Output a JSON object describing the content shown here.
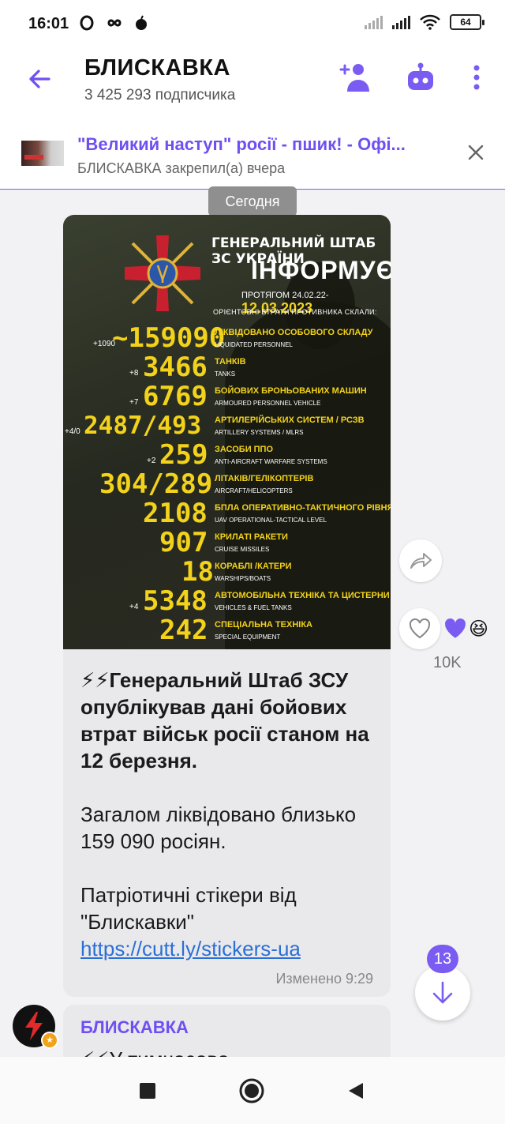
{
  "status_bar": {
    "time": "16:01",
    "left_icons": [
      "opera-icon",
      "infinity-icon",
      "bomb-icon"
    ],
    "battery": "64"
  },
  "header": {
    "title": "БЛИСКАВКА",
    "subtitle": "3 425 293 подписчика"
  },
  "pinned": {
    "title": "\"Великий наступ\" росії - пшик! - Офі...",
    "subtitle": "БЛИСКАВКА закрепил(а) вчера"
  },
  "date_chip": "Сегодня",
  "poster": {
    "heading": "ГЕНЕРАЛЬНИЙ ШТАБ ЗС УКРАЇНИ",
    "title": "ІНФОРМУЄ",
    "range_prefix": "ПРОТЯГОМ 24.02.22-",
    "range_date": "12.03.2023",
    "note": "ОРІЄНТОВНІ ВТРАТИ ПРОТИВНИКА СКЛАЛИ:",
    "stats": [
      {
        "delta": "+1090",
        "value": "~159090",
        "label": "ЛІКВІДОВАНО ОСОБОВОГО СКЛАДУ",
        "en": "LIQUIDATED PERSONNEL"
      },
      {
        "delta": "+8",
        "value": "3466",
        "label": "ТАНКІВ",
        "en": "TANKS"
      },
      {
        "delta": "+7",
        "value": "6769",
        "label": "БОЙОВИХ БРОНЬОВАНИХ МАШИН",
        "en": "ARMOURED PERSONNEL VEHICLE"
      },
      {
        "delta": "+4/0",
        "value": "2487/493",
        "label": "АРТИЛЕРІЙСЬКИХ СИСТЕМ / РСЗВ",
        "en": "ARTILLERY SYSTEMS / MLRS"
      },
      {
        "delta": "+2",
        "value": "259",
        "label": "ЗАСОБИ ППО",
        "en": "ANTI-AIRCRAFT WARFARE SYSTEMS"
      },
      {
        "delta": "",
        "value": "304/289",
        "label": "ЛІТАКІВ/ГЕЛІКОПТЕРІВ",
        "en": "AIRCRAFT/HELICOPTERS"
      },
      {
        "delta": "",
        "value": "2108",
        "label": "БПЛА ОПЕРАТИВНО-ТАКТИЧНОГО РІВНЯ",
        "en": "UAV OPERATIONAL-TACTICAL LEVEL"
      },
      {
        "delta": "",
        "value": "907",
        "label": "КРИЛАТІ РАКЕТИ",
        "en": "CRUISE MISSILES"
      },
      {
        "delta": "",
        "value": "18",
        "label": "КОРАБЛІ /КАТЕРИ",
        "en": "WARSHIPS/BOATS"
      },
      {
        "delta": "+4",
        "value": "5348",
        "label": "АВТОМОБІЛЬНА ТЕХНІКА ТА ЦИСТЕРНИ З ПММ",
        "en": "VEHICLES & FUEL TANKS"
      },
      {
        "delta": "",
        "value": "242",
        "label": "СПЕЦІАЛЬНА ТЕХНІКА",
        "en": "SPECIAL EQUIPMENT"
      }
    ]
  },
  "message": {
    "headline": "⚡⚡Генеральний Штаб ЗСУ опублікував дані бойових втрат військ росії станом на 12 березня.",
    "body": "Загалом ліквідовано близько 159 090 росіян.",
    "promo": "Патріотичні стікери від \"Блискавки\"",
    "link": "https://cutt.ly/stickers-ua",
    "meta": "Изменено  9:29"
  },
  "reactions": {
    "count": "10K",
    "emoji_laugh": "😆"
  },
  "scroll": {
    "unread": "13"
  },
  "message2": {
    "author": "БЛИСКАВКА",
    "text_preview": "⚡⚡У тимчасово"
  }
}
